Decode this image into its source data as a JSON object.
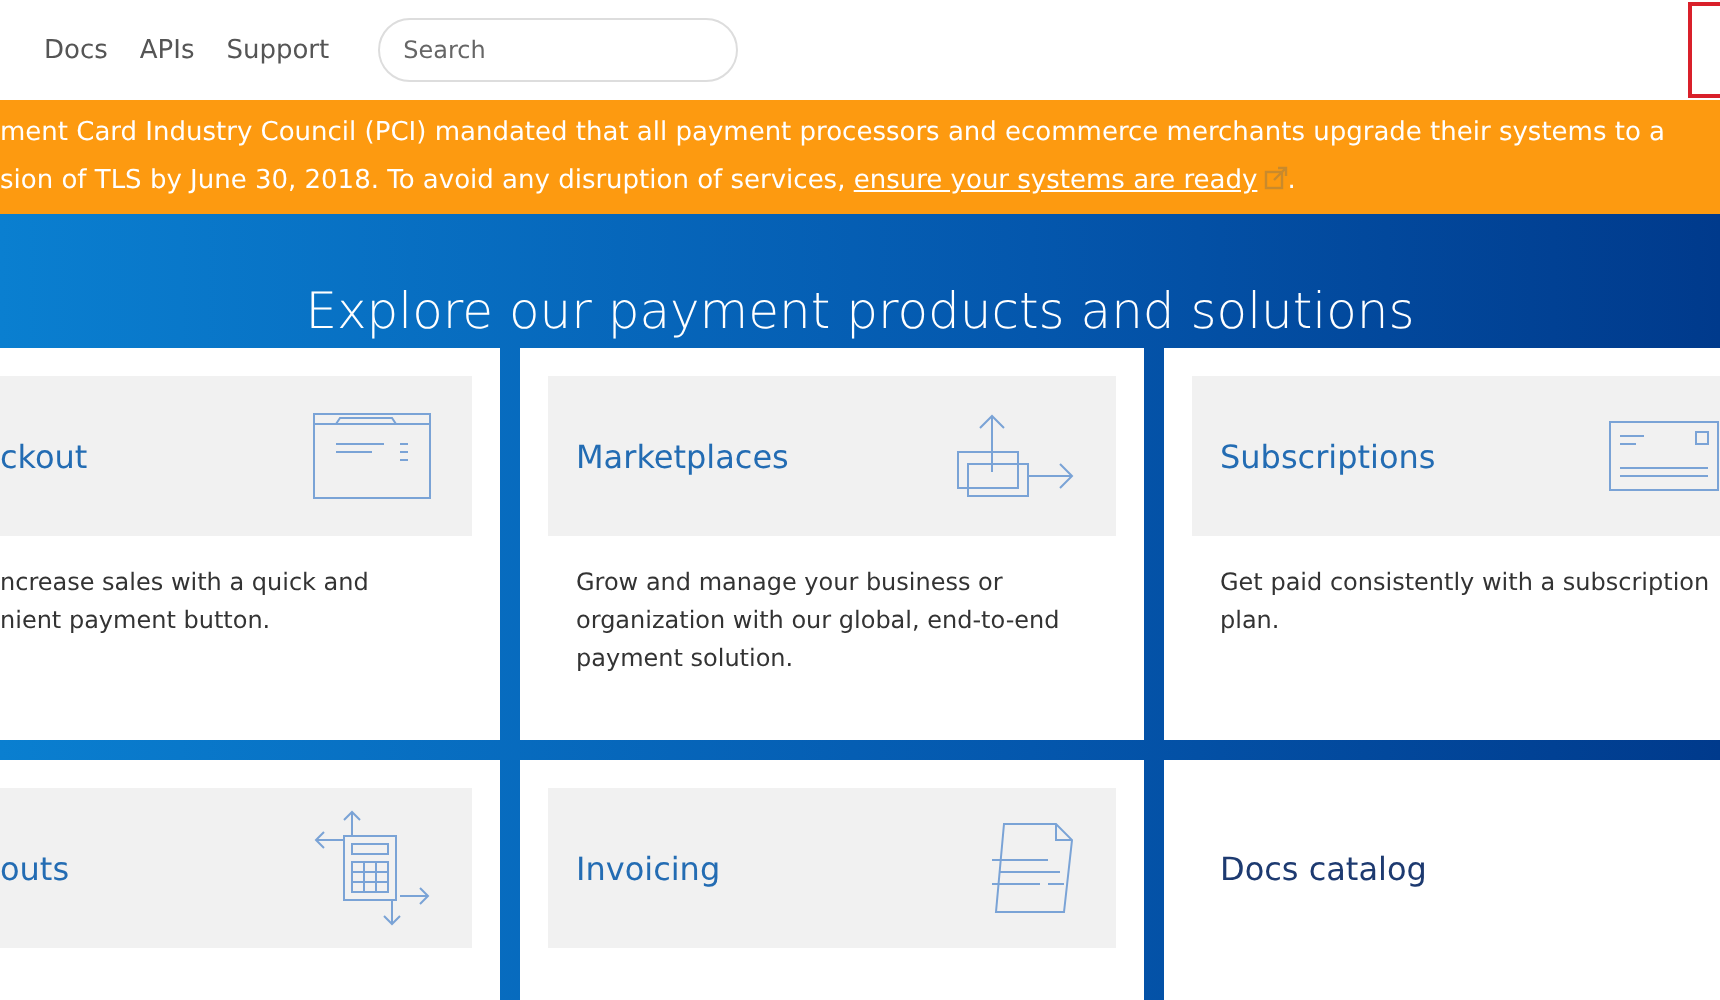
{
  "nav": {
    "links": [
      "Docs",
      "APIs",
      "Support"
    ],
    "search": {
      "placeholder": "Search"
    }
  },
  "banner": {
    "line_1": "ment Card Industry Council (PCI) mandated that all payment processors and ecommerce merchants upgrade their systems to a",
    "line_2": "sion of TLS by June 30, 2018. To avoid any disruption of services, ",
    "link": "ensure your systems are ready",
    "line_2_end": "."
  },
  "hero": {
    "title": "Explore our payment products and solutions"
  },
  "cards": [
    {
      "title": "ckout",
      "kind": "window",
      "description": [
        "ncrease sales with a quick and",
        "nient payment button."
      ]
    },
    {
      "title": "Marketplaces",
      "kind": "transfer",
      "description": [
        "Grow and manage your business or",
        "organization with our global, end-to-end",
        "payment solution."
      ]
    },
    {
      "title": "Subscriptions",
      "kind": "card",
      "description": [
        "Get paid consistently with a subscription",
        "plan."
      ]
    },
    {
      "title": "outs",
      "kind": "calculator"
    },
    {
      "title": "Invoicing",
      "kind": "document"
    },
    {
      "title": "Docs catalog",
      "kind": "plain"
    }
  ]
}
